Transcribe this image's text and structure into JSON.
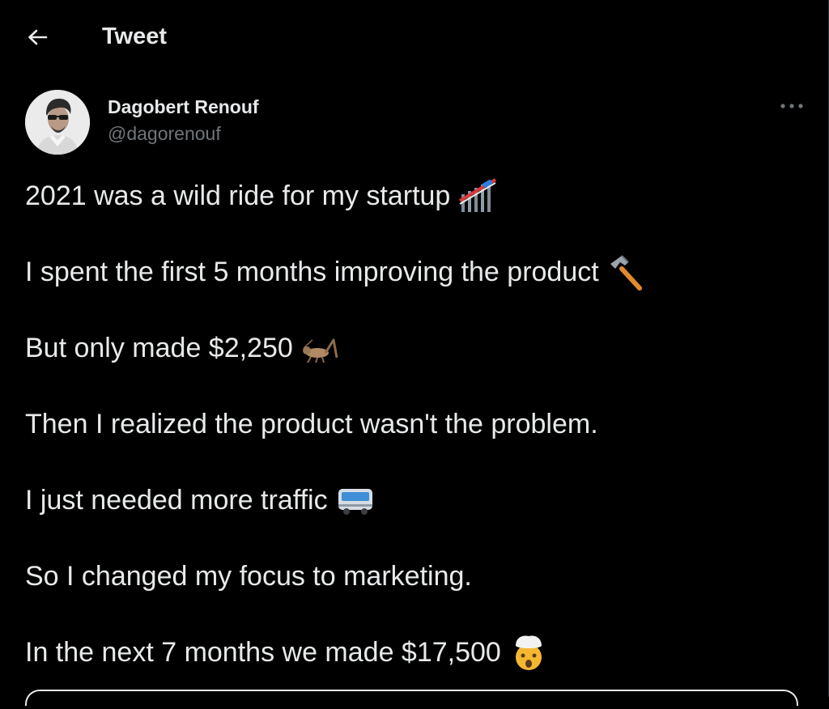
{
  "header": {
    "back_icon": "arrow-left-icon",
    "title": "Tweet"
  },
  "author": {
    "display_name": "Dagobert Renouf",
    "handle": "@dagorenouf",
    "more_icon": "more-horizontal-icon"
  },
  "tweet": {
    "lines": [
      {
        "text": "2021 was a wild ride for my startup",
        "emoji": "roller-coaster"
      },
      {
        "text": "I spent the first 5 months improving the product",
        "emoji": "hammer"
      },
      {
        "text": "But only made $2,250",
        "emoji": "cricket"
      },
      {
        "text": "Then I realized the product wasn't the problem.",
        "emoji": ""
      },
      {
        "text": "I just needed more traffic",
        "emoji": "bus"
      },
      {
        "text": "So I changed my focus to marketing.",
        "emoji": ""
      },
      {
        "text": "In the next 7 months we made $17,500",
        "emoji": "exploding-head"
      }
    ]
  },
  "colors": {
    "background": "#000000",
    "primary_text": "#e7e9ea",
    "secondary_text": "#71767b",
    "divider": "#2f3336"
  }
}
